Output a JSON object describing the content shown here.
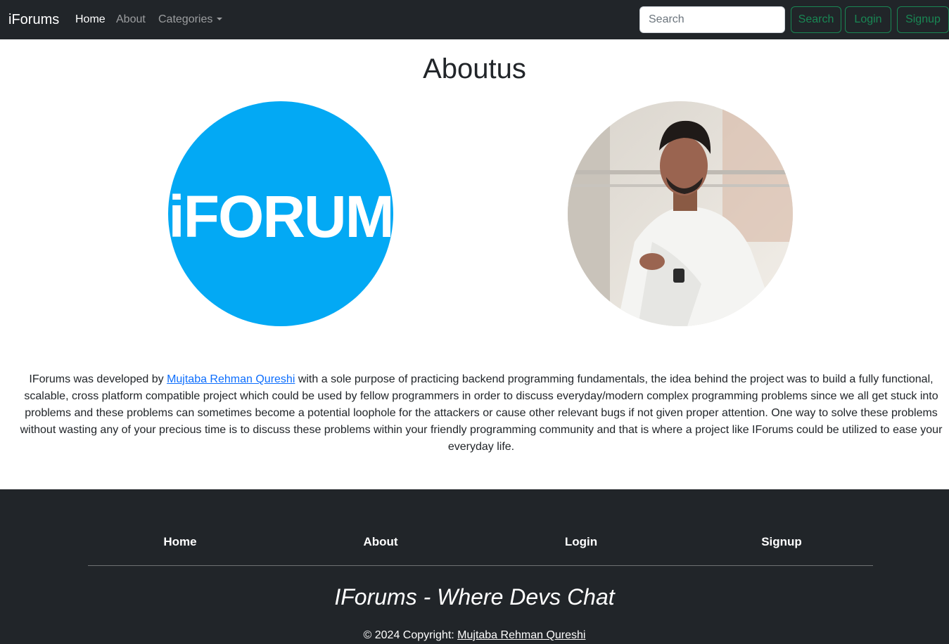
{
  "navbar": {
    "brand": "iForums",
    "links": [
      {
        "label": "Home"
      },
      {
        "label": "About"
      },
      {
        "label": "Categories"
      }
    ],
    "search_placeholder": "Search",
    "search_button": "Search",
    "login_button": "Login",
    "signup_button": "Signup"
  },
  "main": {
    "title": "Aboutus",
    "logo_text": "iFORUM",
    "about_prefix": "IForums was developed by ",
    "author_link": "Mujtaba Rehman Qureshi",
    "about_suffix": " with a sole purpose of practicing backend programming fundamentals, the idea behind the project was to build a fully functional, scalable, cross platform compatible project which could be used by fellow programmers in order to discuss everyday/modern complex programming problems since we all get stuck into problems and these problems can sometimes become a potential loophole for the attackers or cause other relevant bugs if not given proper attention. One way to solve these problems without wasting any of your precious time is to discuss these problems within your friendly programming community and that is where a project like IForums could be utilized to ease your everyday life."
  },
  "footer": {
    "links": [
      {
        "label": "Home"
      },
      {
        "label": "About"
      },
      {
        "label": "Login"
      },
      {
        "label": "Signup"
      }
    ],
    "tagline": "IForums - Where Devs Chat",
    "copyright_prefix": "© 2024 Copyright: ",
    "copyright_link": "Mujtaba Rehman Qureshi"
  },
  "colors": {
    "navbar_bg": "#212529",
    "accent_green": "#198754",
    "logo_blue": "#03a9f4",
    "link_blue": "#0d6efd"
  }
}
